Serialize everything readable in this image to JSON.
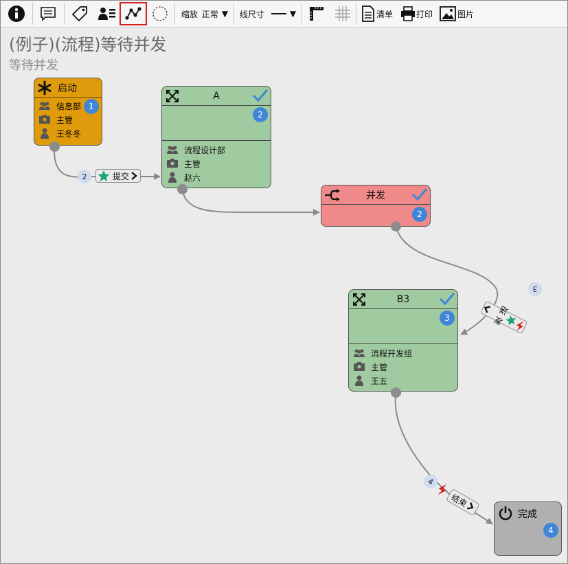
{
  "toolbar": {
    "zoom_label": "缩放",
    "zoom_value": "正常",
    "line_label": "线尺寸",
    "list_label": "清单",
    "print_label": "打印",
    "image_label": "图片"
  },
  "diagram": {
    "title": "(例子)(流程)等待并发",
    "subtitle": "等待并发"
  },
  "nodes": {
    "start": {
      "title": "启动",
      "badge": "1",
      "rows": [
        "信息部",
        "主管",
        "王冬冬"
      ],
      "color": "#e09b0c"
    },
    "a": {
      "title": "A",
      "badge": "2",
      "rows": [
        "流程设计部",
        "主管",
        "赵六"
      ],
      "color": "#a0cba0"
    },
    "concurrent": {
      "title": "并发",
      "badge": "2",
      "color": "#f08a8a"
    },
    "b3": {
      "title": "B3",
      "badge": "3",
      "rows": [
        "流程开发组",
        "主管",
        "王五"
      ],
      "color": "#a0cba0"
    },
    "done": {
      "title": "完成",
      "badge": "4",
      "color": "#b0b0b0"
    }
  },
  "links": {
    "submit": {
      "label": "提交",
      "badge": "2"
    },
    "send": {
      "label": "发送",
      "badge": "3"
    },
    "finish": {
      "label": "结束",
      "badge": "4"
    }
  },
  "colors": {
    "check": "#3f86d8",
    "star": "#1aa37a",
    "lightning": "#d4231c",
    "badge": "#3f86d8"
  }
}
